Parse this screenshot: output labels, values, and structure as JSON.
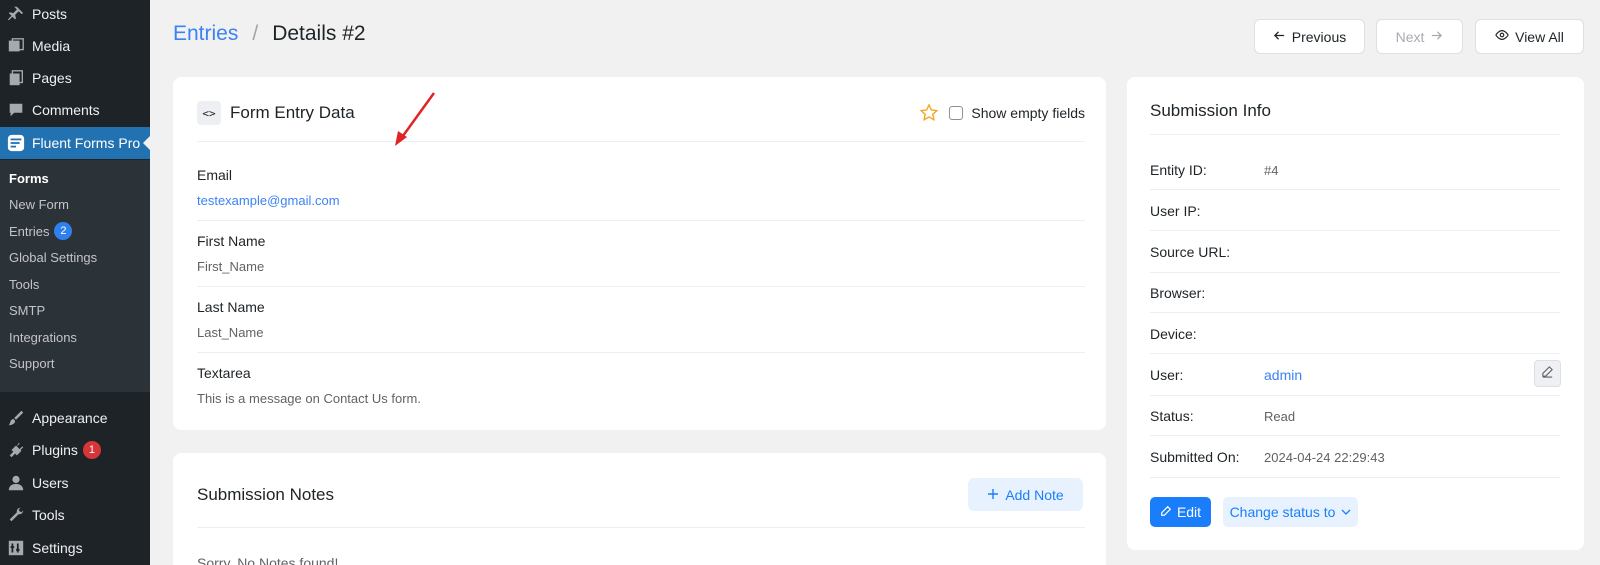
{
  "sidebar": {
    "items": [
      {
        "label": "Posts",
        "icon": "pin-icon"
      },
      {
        "label": "Media",
        "icon": "media-icon"
      },
      {
        "label": "Pages",
        "icon": "pages-icon"
      },
      {
        "label": "Comments",
        "icon": "comment-icon"
      },
      {
        "label": "Fluent Forms Pro",
        "icon": "fluent-forms-icon"
      },
      {
        "label": "Appearance",
        "icon": "brush-icon"
      },
      {
        "label": "Plugins",
        "icon": "plugin-icon",
        "badge": "1"
      },
      {
        "label": "Users",
        "icon": "user-icon"
      },
      {
        "label": "Tools",
        "icon": "wrench-icon"
      },
      {
        "label": "Settings",
        "icon": "settings-icon"
      }
    ],
    "submenu": [
      {
        "label": "Forms"
      },
      {
        "label": "New Form"
      },
      {
        "label": "Entries",
        "badge": "2"
      },
      {
        "label": "Global Settings"
      },
      {
        "label": "Tools"
      },
      {
        "label": "SMTP"
      },
      {
        "label": "Integrations"
      },
      {
        "label": "Support"
      }
    ]
  },
  "breadcrumb": {
    "parent": "Entries",
    "separator": "/",
    "current": "Details #2"
  },
  "toolbar": {
    "previous": "Previous",
    "next": "Next",
    "view_all": "View All"
  },
  "entry_card": {
    "icon_text": "<>",
    "title": "Form Entry Data",
    "show_empty": "Show empty fields",
    "fields": [
      {
        "label": "Email",
        "value": "testexample@gmail.com"
      },
      {
        "label": "First Name",
        "value": "First_Name"
      },
      {
        "label": "Last Name",
        "value": "Last_Name"
      },
      {
        "label": "Textarea",
        "value": "This is a message on Contact Us form."
      }
    ]
  },
  "notes_card": {
    "title": "Submission Notes",
    "add_note": "Add Note",
    "empty": "Sorry, No Notes found!"
  },
  "info_card": {
    "title": "Submission Info",
    "rows": [
      {
        "label": "Entity ID:",
        "value": "#4"
      },
      {
        "label": "User IP:",
        "value": ""
      },
      {
        "label": "Source URL:",
        "value": ""
      },
      {
        "label": "Browser:",
        "value": ""
      },
      {
        "label": "Device:",
        "value": ""
      },
      {
        "label": "User:",
        "value": "admin"
      },
      {
        "label": "Status:",
        "value": "Read"
      },
      {
        "label": "Submitted On:",
        "value": "2024-04-24 22:29:43"
      }
    ],
    "edit": "Edit",
    "change_status": "Change status to"
  },
  "colors": {
    "accent": "#1a7efb",
    "sidebar": "#1d2327",
    "active": "#2271b1",
    "annotation_arrow": "#e02424"
  }
}
